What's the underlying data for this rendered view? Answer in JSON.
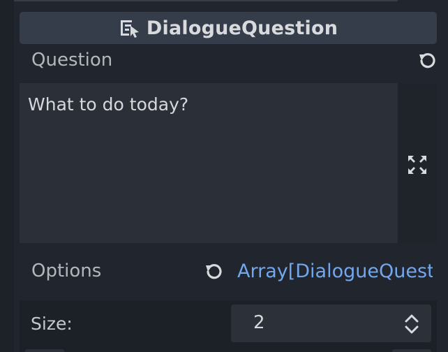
{
  "header": {
    "title": "DialogueQuestion",
    "icon": "script-cursor-icon"
  },
  "question": {
    "label": "Question",
    "value": "What to do today?",
    "revert_icon": "revert-icon",
    "expand_icon": "expand-icon"
  },
  "options": {
    "label": "Options",
    "value": "Array[DialogueQuest",
    "revert_icon": "revert-icon",
    "link_color": "#72a7ef"
  },
  "size": {
    "label": "Size:",
    "value": "2"
  },
  "colors": {
    "panel": "#21262e",
    "header": "#363d4a",
    "field": "#2a2f38"
  }
}
